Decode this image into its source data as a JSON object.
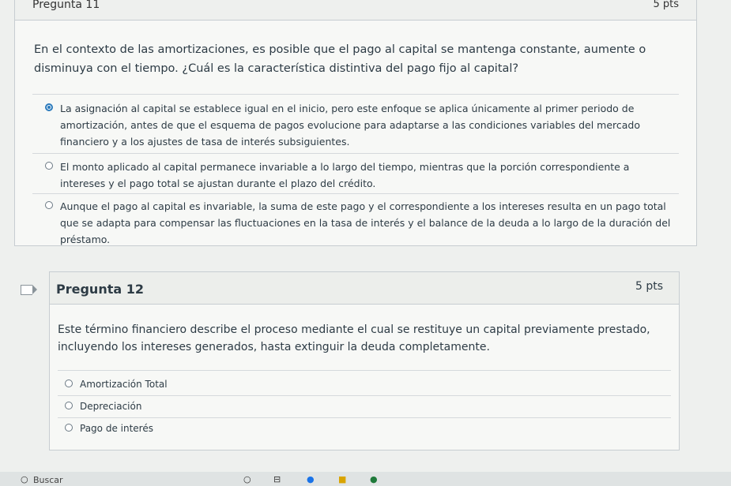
{
  "q11": {
    "title": "Pregunta 11",
    "points": "5 pts",
    "question": "En el contexto de las amortizaciones, es posible que el pago al capital se mantenga constante, aumente o disminuya con el tiempo. ¿Cuál es la característica distintiva del pago fijo al capital?",
    "answers": [
      {
        "text": "La asignación al capital se establece igual en el inicio, pero este enfoque se aplica únicamente al primer periodo de amortización, antes de que el esquema de pagos evolucione para adaptarse a las condiciones variables del mercado financiero y a los ajustes de tasa de interés subsiguientes.",
        "selected": true
      },
      {
        "text": "El monto aplicado al capital permanece invariable a lo largo del tiempo, mientras que la porción correspondiente a intereses y el pago total se ajustan durante el plazo del crédito.",
        "selected": false
      },
      {
        "text": "Aunque el pago al capital es invariable, la suma de este pago y el correspondiente a los intereses resulta en un pago total que se adapta para compensar las fluctuaciones en la tasa de interés y el balance de la deuda a lo largo de la duración del préstamo.",
        "selected": false
      }
    ]
  },
  "q12": {
    "title": "Pregunta 12",
    "points": "5 pts",
    "question": "Este término financiero describe el proceso mediante el cual se restituye un capital previamente prestado, incluyendo los intereses generados, hasta extinguir la deuda completamente.",
    "answers": [
      {
        "text": "Amortización Total",
        "selected": false
      },
      {
        "text": "Depreciación",
        "selected": false
      },
      {
        "text": "Pago de interés",
        "selected": false
      }
    ]
  },
  "taskbar": {
    "search_label": "Buscar"
  },
  "colors": {
    "accent": "#2b7abc",
    "text": "#2d3b45",
    "background": "#eef0ee"
  }
}
